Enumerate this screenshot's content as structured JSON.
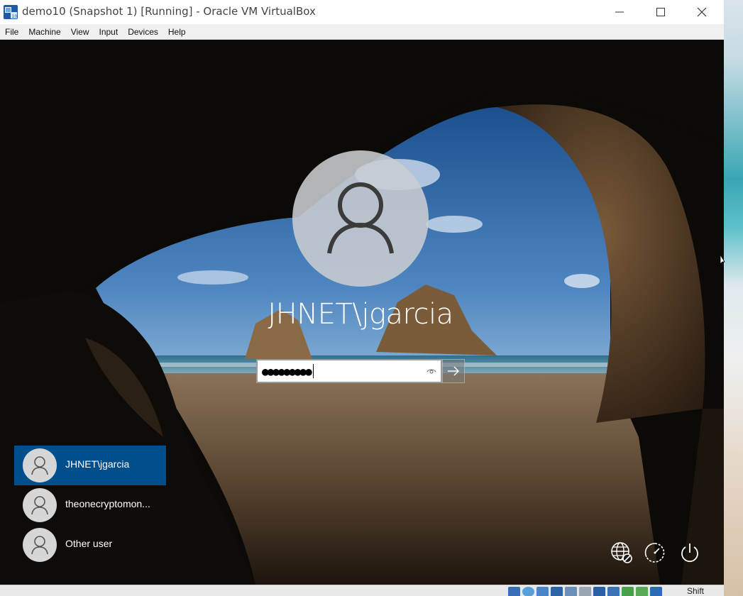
{
  "window": {
    "title": "demo10 (Snapshot 1) [Running] - Oracle VM VirtualBox",
    "app_icon": "virtualbox-icon",
    "controls": [
      "minimize-icon",
      "maximize-icon",
      "close-icon"
    ]
  },
  "menubar": {
    "items": [
      "File",
      "Machine",
      "View",
      "Input",
      "Devices",
      "Help"
    ]
  },
  "lockscreen": {
    "user_name": "JHNET\\jgarcia",
    "password_masked": "●●●●●●●●●",
    "password_length": 9,
    "reveal_icon": "eye-icon",
    "submit_icon": "arrow-right-icon",
    "users": [
      {
        "label": "JHNET\\jgarcia",
        "selected": true
      },
      {
        "label": "theonecryptomon...",
        "selected": false
      },
      {
        "label": "Other user",
        "selected": false
      }
    ],
    "corner_icons": [
      "network-icon",
      "ease-of-access-icon",
      "power-icon"
    ]
  },
  "statusbar": {
    "host_key": "Shift",
    "icons": [
      "hard-disk-icon",
      "optical-drive-icon",
      "audio-icon",
      "network-adapter-icon",
      "usb-icon",
      "shared-folders-icon",
      "display-icon",
      "recording-icon",
      "guest-additions-icon",
      "mouse-integration-icon",
      "keyboard-capture-icon",
      "arrow-down-icon"
    ]
  },
  "colors": {
    "selected_tile": "#004e8c",
    "titlebar": "#ffffff",
    "menubar": "#f0f0f0"
  }
}
